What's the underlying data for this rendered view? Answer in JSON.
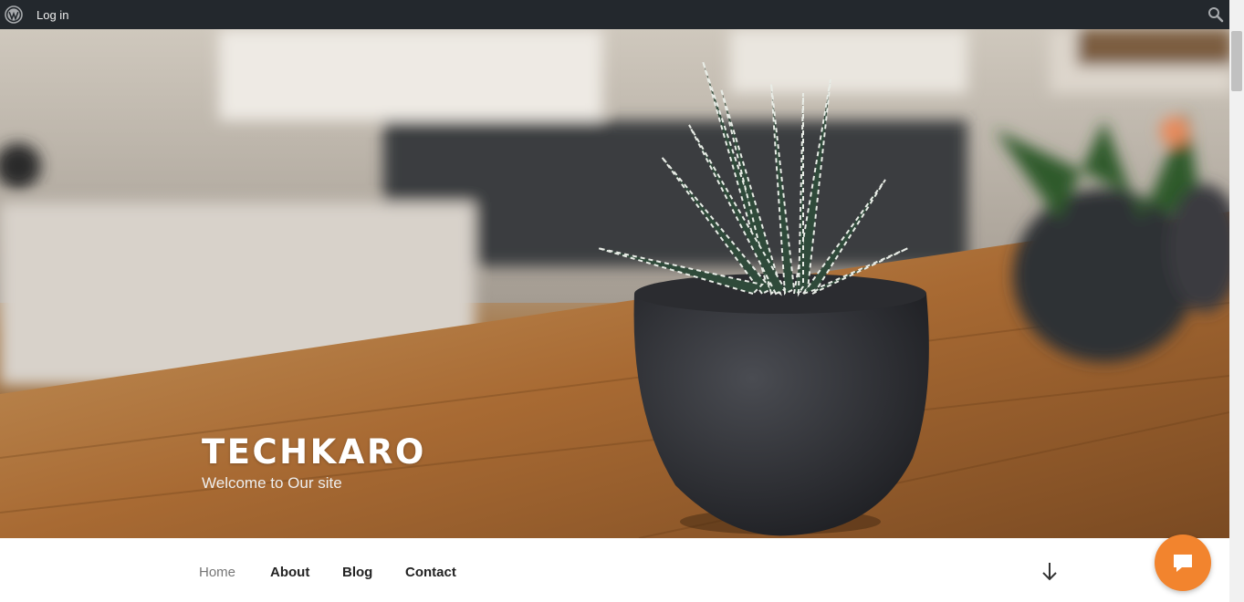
{
  "adminbar": {
    "login_label": "Log in",
    "icons": [
      "wordpress-icon",
      "search-icon"
    ]
  },
  "hero": {
    "site_title": "TECHKARO",
    "site_description": "Welcome to Our site"
  },
  "nav": {
    "items": [
      {
        "label": "Home",
        "current": true
      },
      {
        "label": "About"
      },
      {
        "label": "Blog"
      },
      {
        "label": "Contact"
      }
    ],
    "scroll_icon": "arrow-down-icon"
  },
  "chat": {
    "icon": "chat-bubble-icon",
    "color": "#f2842e"
  },
  "colors": {
    "adminbar": "#23282d",
    "accent": "#f2842e"
  }
}
